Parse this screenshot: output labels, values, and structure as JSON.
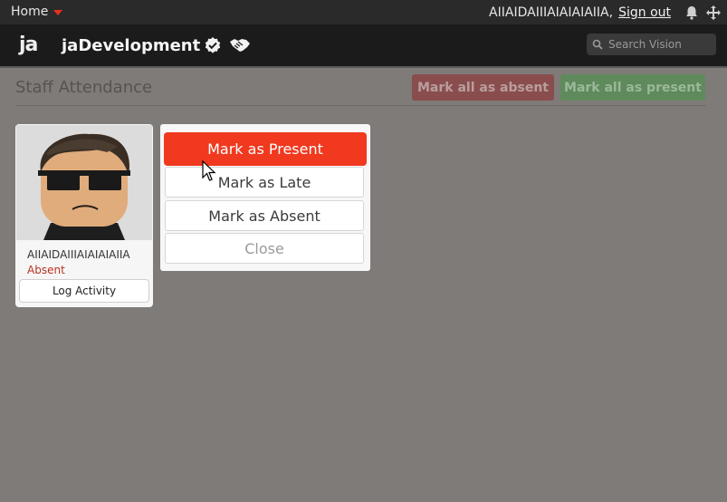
{
  "topbar": {
    "home_label": "Home",
    "username": "AIIAIDAIIIAIAIAIAIIA,",
    "signout_label": "Sign out",
    "icons": [
      "bell-icon",
      "move-icon"
    ]
  },
  "header": {
    "logo": "ja",
    "brand": "jaDevelopment",
    "icons": [
      "verified-badge-icon",
      "handshake-icon"
    ],
    "search_placeholder": "Search Vision"
  },
  "page": {
    "title": "Staff Attendance",
    "mark_all_absent": "Mark all as absent",
    "mark_all_present": "Mark all as present"
  },
  "card": {
    "name": "AIIAIDAIIIAIAIAIAIIA",
    "status": "Absent",
    "log_button": "Log Activity"
  },
  "menu": {
    "present": "Mark as Present",
    "late": "Mark as Late",
    "absent": "Mark as Absent",
    "close": "Close"
  },
  "colors": {
    "accent": "#f0391f",
    "background": "#7f7b79",
    "header": "#1b1b1b",
    "absent_button": "#8a4d4d",
    "present_button": "#5f8a5c"
  }
}
